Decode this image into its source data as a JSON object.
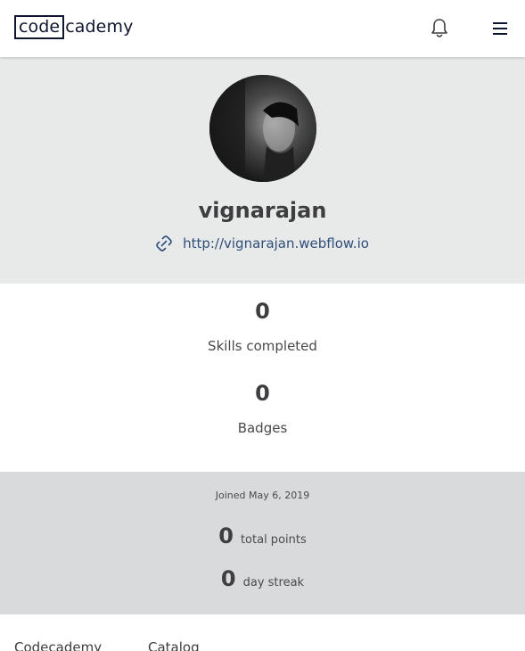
{
  "header": {
    "logo": {
      "box_text": "code",
      "rest_text": "cademy"
    },
    "icons": {
      "notifications": "bell-icon",
      "menu": "hamburger-menu-icon"
    }
  },
  "profile": {
    "avatar_alt": "profile photo",
    "username": "vignarajan",
    "website": {
      "icon": "link-icon",
      "url": "http://vignarajan.webflow.io"
    }
  },
  "stats": [
    {
      "value": "0",
      "label": "Skills completed"
    },
    {
      "value": "0",
      "label": "Badges"
    }
  ],
  "activity": {
    "joined": "Joined May 6, 2019",
    "total_points": {
      "value": "0",
      "label": "total points"
    },
    "day_streak": {
      "value": "0",
      "label": "day streak"
    }
  },
  "footer": {
    "columns": [
      "Codecademy",
      "Catalog"
    ]
  },
  "colors": {
    "brand": "#10162f",
    "profile_bg": "#e8e9e9",
    "points_bg": "#d9dadc",
    "link": "#2f4f7a"
  }
}
